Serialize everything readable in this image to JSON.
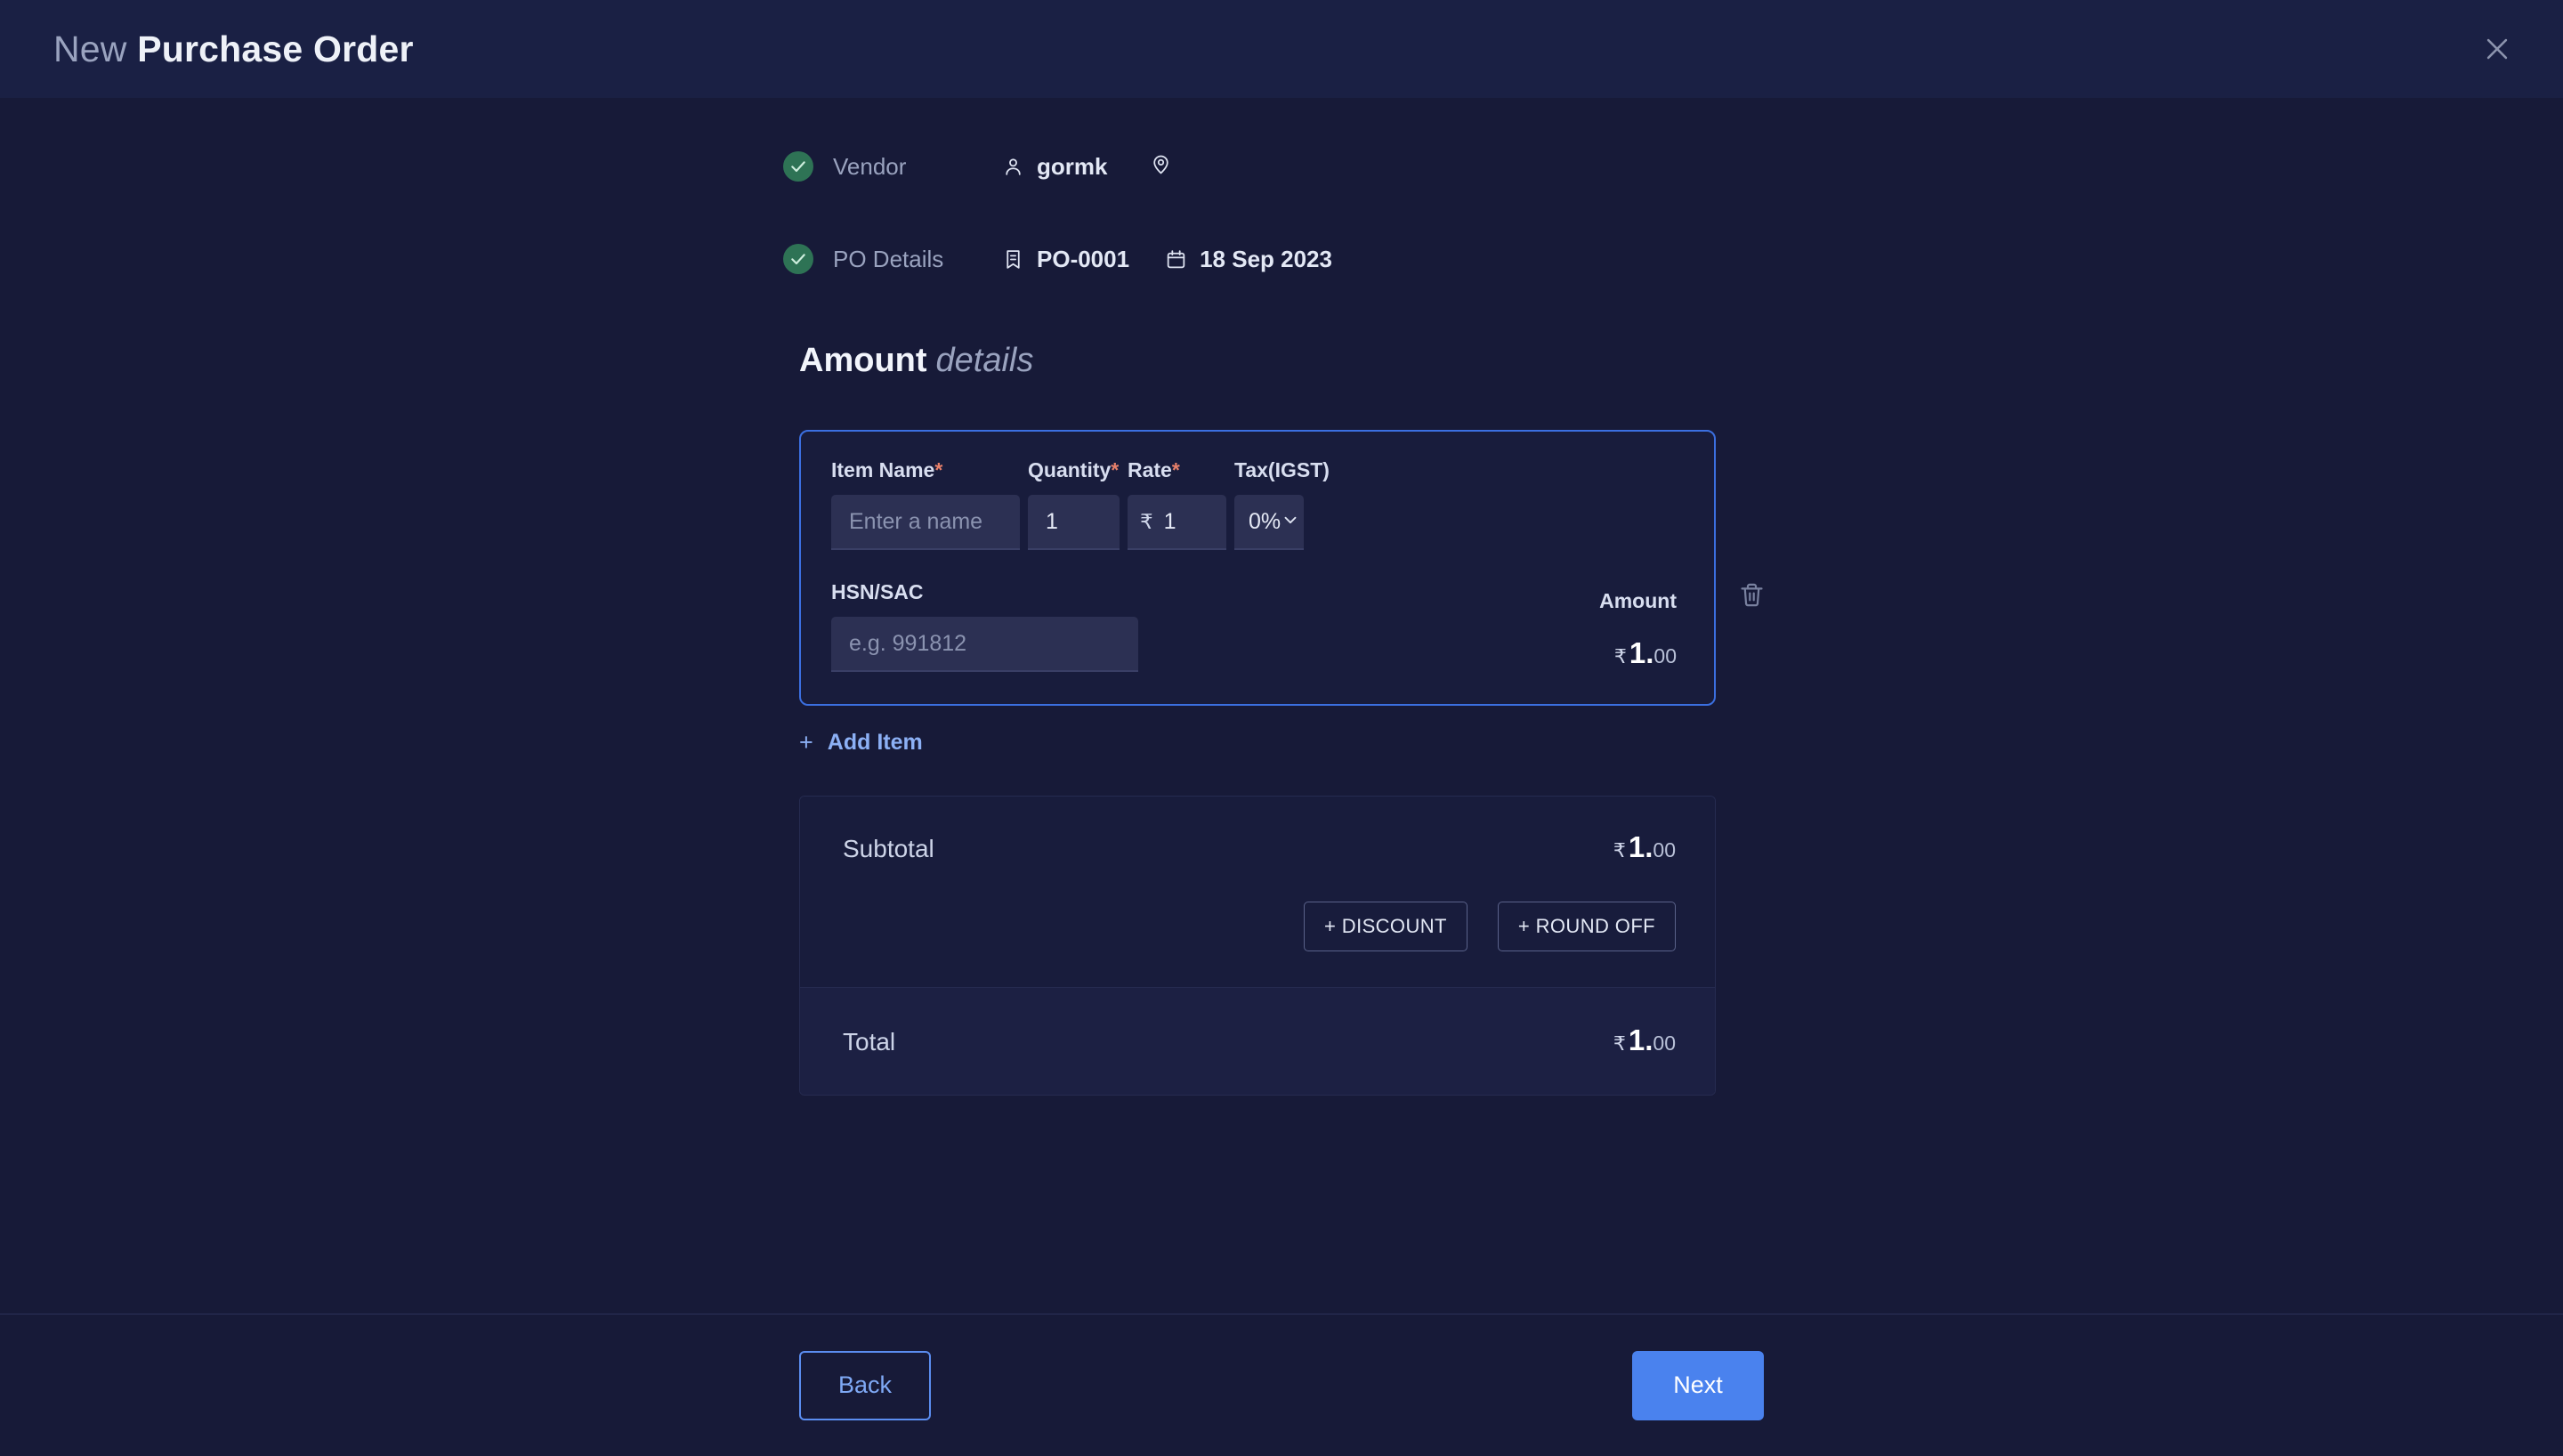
{
  "header": {
    "title_light": "New",
    "title_bold": "Purchase Order",
    "close_icon": "close-icon",
    "progress_percent": 79
  },
  "steps": [
    {
      "label": "Vendor",
      "status_icon": "check-circle-icon",
      "chips": [
        {
          "icon": "user-icon",
          "text": "gormk"
        },
        {
          "icon": "map-pin-icon",
          "text": ""
        }
      ]
    },
    {
      "label": "PO Details",
      "status_icon": "check-circle-icon",
      "chips": [
        {
          "icon": "receipt-icon",
          "text": "PO-0001"
        },
        {
          "icon": "calendar-icon",
          "text": "18 Sep 2023"
        }
      ]
    }
  ],
  "section": {
    "heading_bold": "Amount",
    "heading_italic": "details"
  },
  "item_row": {
    "labels": {
      "item_name": "Item Name",
      "quantity": "Quantity",
      "rate": "Rate",
      "tax": "Tax(IGST)",
      "hsn": "HSN/SAC",
      "amount": "Amount",
      "required_mark": "*"
    },
    "values": {
      "item_name": "",
      "item_name_placeholder": "Enter a name",
      "quantity": "1",
      "rate": "1",
      "rate_symbol": "₹",
      "tax": "0%",
      "hsn": "",
      "hsn_placeholder": "e.g. 991812"
    },
    "amount": {
      "symbol": "₹",
      "main": "1.",
      "cents": "00"
    },
    "delete_icon": "trash-icon",
    "dropdown_icon": "chevron-down-icon"
  },
  "add_item": {
    "plus": "+",
    "label": "Add Item"
  },
  "totals": {
    "subtotal_label": "Subtotal",
    "subtotal": {
      "symbol": "₹",
      "main": "1.",
      "cents": "00"
    },
    "discount_label": "+  DISCOUNT",
    "roundoff_label": "+  ROUND OFF",
    "total_label": "Total",
    "total": {
      "symbol": "₹",
      "main": "1.",
      "cents": "00"
    }
  },
  "footer": {
    "back_label": "Back",
    "next_label": "Next"
  },
  "colors": {
    "page_bg": "#171a38",
    "header_bg": "#1a2044",
    "accent_blue": "#4a7ae0",
    "card_border": "#3b6fe0",
    "input_bg": "#2c3053",
    "required_red": "#e8806a",
    "check_green": "#2e7355",
    "link_blue": "#8cb0f5",
    "total_row_bg": "#1c2043"
  }
}
